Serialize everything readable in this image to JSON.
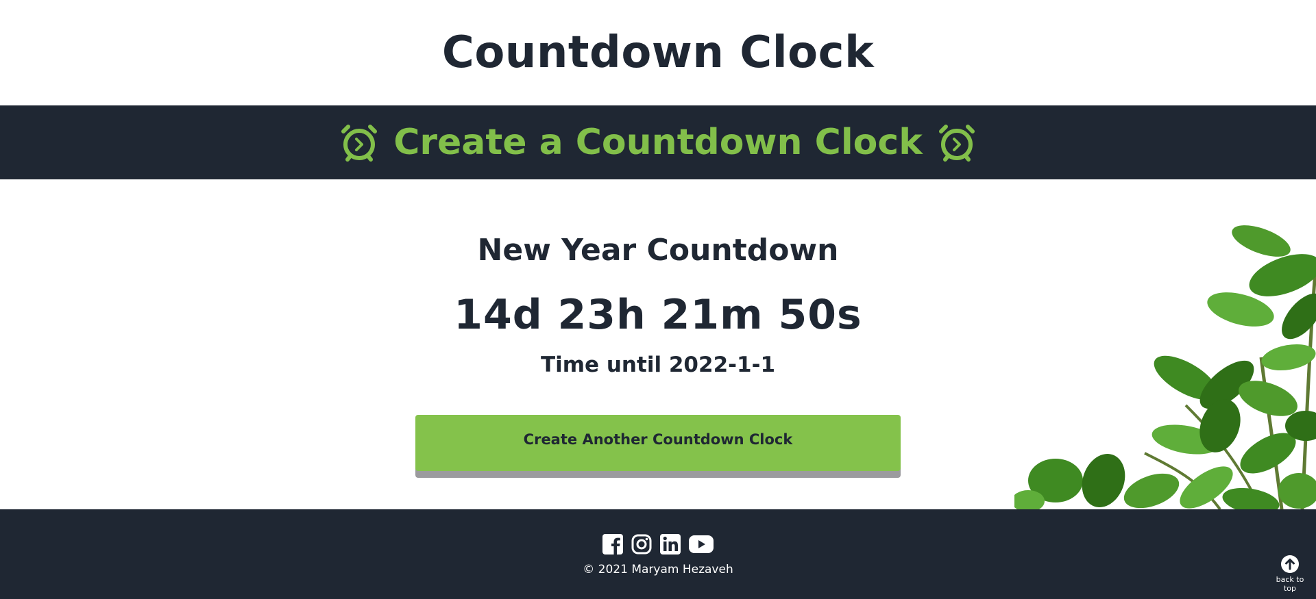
{
  "header": {
    "title": "Countdown Clock"
  },
  "banner": {
    "title": "Create a Countdown Clock",
    "left_icon": "alarm-clock-icon",
    "right_icon": "alarm-clock-icon",
    "accent_color": "#82bf4a"
  },
  "countdown": {
    "title": "New Year Countdown",
    "time": "14d 23h 21m 50s",
    "subtitle": "Time until 2022-1-1"
  },
  "actions": {
    "create_another_label": "Create Another Countdown Clock"
  },
  "decor": {
    "image": "plant-image"
  },
  "footer": {
    "socials": [
      {
        "name": "facebook",
        "icon": "facebook-icon"
      },
      {
        "name": "instagram",
        "icon": "instagram-icon"
      },
      {
        "name": "linkedin",
        "icon": "linkedin-icon"
      },
      {
        "name": "youtube",
        "icon": "youtube-icon"
      }
    ],
    "copyright": "© 2021 Maryam Hezaveh",
    "back_to_top_label": "back to top",
    "back_to_top_icon": "arrow-up-circle-icon",
    "background_color": "#1f2733"
  }
}
